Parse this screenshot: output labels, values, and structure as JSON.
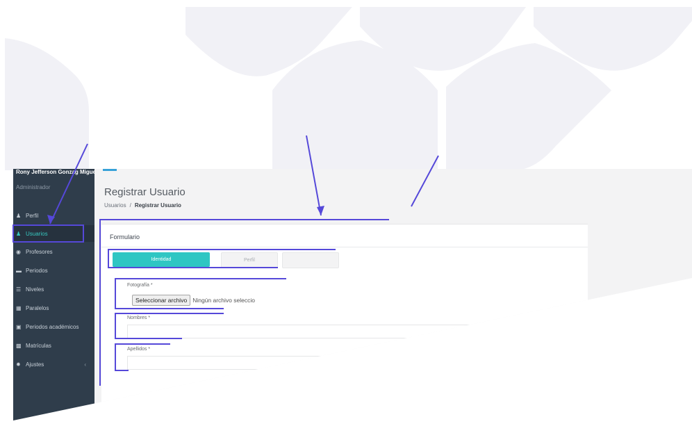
{
  "user": {
    "name": "Rony Jefferson Gonzag Miguez",
    "role": "Administrador"
  },
  "sidebar": {
    "items": [
      {
        "label": "Perfil",
        "icon": "user-icon"
      },
      {
        "label": "Usuarios",
        "icon": "users-icon",
        "active": true
      },
      {
        "label": "Profesores",
        "icon": "user-circle-icon"
      },
      {
        "label": "Periodos",
        "icon": "calendar-bar-icon"
      },
      {
        "label": "Niveles",
        "icon": "list-icon"
      },
      {
        "label": "Paralelos",
        "icon": "grid-icon"
      },
      {
        "label": "Periodos académicos",
        "icon": "calendar-icon"
      },
      {
        "label": "Matrículas",
        "icon": "book-icon"
      },
      {
        "label": "Ajustes",
        "icon": "gear-icon",
        "arrow": "‹"
      }
    ]
  },
  "page": {
    "title": "Registrar Usuario",
    "breadcrumb": {
      "root": "Usuarios",
      "separator": "/",
      "current": "Registrar Usuario"
    }
  },
  "form": {
    "title": "Formulario",
    "tabs": [
      {
        "label": "Identidad",
        "active": true
      },
      {
        "label": "Perfil"
      }
    ],
    "fields": {
      "photo_label": "Fotografía *",
      "file_button": "Seleccionar archivo",
      "file_status": "Ningún archivo seleccio",
      "names_label": "Nombres *",
      "surnames_label": "Apellidos *"
    }
  },
  "colors": {
    "sidebar_bg": "#2f3d4b",
    "accent": "#2fc6c3",
    "annotation": "#5548d9",
    "background_shape": "#f1f1f6"
  }
}
